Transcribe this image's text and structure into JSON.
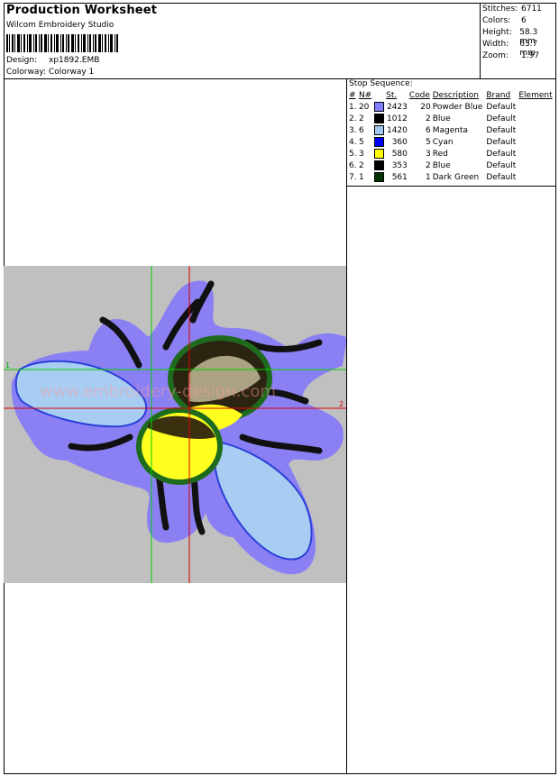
{
  "header": {
    "title": "Production Worksheet",
    "software": "Wilcom Embroidery Studio",
    "design_label": "Design:",
    "design_value": "xp1892.EMB",
    "colorway_label": "Colorway:",
    "colorway_value": "Colorway 1"
  },
  "stats": [
    {
      "label": "Stitches:",
      "value": "6711"
    },
    {
      "label": "Colors:",
      "value": "6"
    },
    {
      "label": "Height:",
      "value": "58.3 mm"
    },
    {
      "label": "Width:",
      "value": "63.7 mm"
    },
    {
      "label": "Zoom:",
      "value": "1.97"
    }
  ],
  "stop_sequence": {
    "title": "Stop Sequence:",
    "columns": [
      "#",
      "N#",
      "St.",
      "Code",
      "Description",
      "Brand",
      "Element"
    ],
    "rows": [
      {
        "num": "1.",
        "n": "20",
        "color": "#7f7fff",
        "st": "2423",
        "code": "20",
        "desc": "Powder Blue",
        "brand": "Default",
        "element": ""
      },
      {
        "num": "2.",
        "n": "2",
        "color": "#000000",
        "st": "1012",
        "code": "2",
        "desc": "Blue",
        "brand": "Default",
        "element": ""
      },
      {
        "num": "3.",
        "n": "6",
        "color": "#9fc8f0",
        "st": "1420",
        "code": "6",
        "desc": "Magenta",
        "brand": "Default",
        "element": ""
      },
      {
        "num": "4.",
        "n": "5",
        "color": "#0000ff",
        "st": "360",
        "code": "5",
        "desc": "Cyan",
        "brand": "Default",
        "element": ""
      },
      {
        "num": "5.",
        "n": "3",
        "color": "#ffff00",
        "st": "580",
        "code": "3",
        "desc": "Red",
        "brand": "Default",
        "element": ""
      },
      {
        "num": "6.",
        "n": "2",
        "color": "#000000",
        "st": "353",
        "code": "2",
        "desc": "Blue",
        "brand": "Default",
        "element": ""
      },
      {
        "num": "7.",
        "n": "1",
        "color": "#003300",
        "st": "561",
        "code": "1",
        "desc": "Dark Green",
        "brand": "Default",
        "element": ""
      }
    ]
  },
  "design_preview": {
    "background": "#c0c0c0",
    "axis_label_left": "1",
    "axis_label_right": "2",
    "watermark": "www.embroidery-design.com"
  }
}
